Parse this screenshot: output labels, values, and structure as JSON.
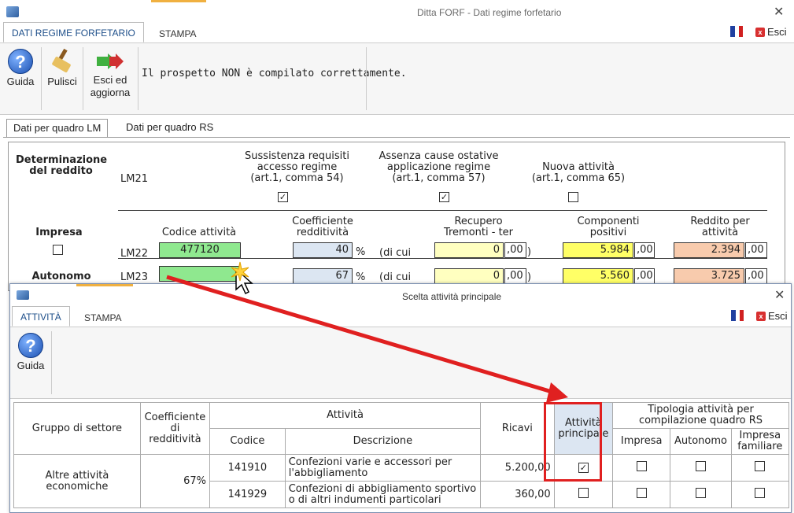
{
  "main_window": {
    "title": "Ditta FORF - Dati regime forfetario",
    "close": "✕",
    "ribbon_tabs": [
      "DATI REGIME FORFETARIO",
      "STAMPA"
    ],
    "esci": "Esci",
    "toolbar": {
      "guida": "Guida",
      "pulisci": "Pulisci",
      "esci_aggiorna_1": "Esci ed",
      "esci_aggiorna_2": "aggiorna",
      "status": "Il prospetto NON è compilato correttamente."
    },
    "doc_tabs": [
      "Dati per quadro LM",
      "Dati per quadro RS"
    ],
    "form": {
      "determinazione_1": "Determinazione",
      "determinazione_2": "del reddito",
      "lm21": "LM21",
      "sussistenza_1": "Sussistenza requisiti",
      "sussistenza_2": "accesso regime",
      "sussistenza_3": "(art.1, comma 54)",
      "assenza_1": "Assenza cause ostative",
      "assenza_2": "applicazione regime",
      "assenza_3": "(art.1, comma 57)",
      "nuova_1": "Nuova attività",
      "nuova_2": "(art.1, comma 65)",
      "check": "✓",
      "impresa": "Impresa",
      "autonomo": "Autonomo",
      "codice_attivita": "Codice attività",
      "coeff_1": "Coefficiente",
      "coeff_2": "redditività",
      "recupero_1": "Recupero",
      "recupero_2": "Tremonti - ter",
      "componenti_1": "Componenti",
      "componenti_2": "positivi",
      "reddito_1": "Reddito per",
      "reddito_2": "attività",
      "lm22": "LM22",
      "lm23": "LM23",
      "percent": "%",
      "di_cui": "(di cui",
      "zero": "0",
      "dec": ",00",
      "paren": ")",
      "lm22_codice": "477120",
      "lm22_coeff": "40",
      "lm22_componenti": "5.984",
      "lm22_reddito": "2.394",
      "lm23_codice": "",
      "lm23_coeff": "67",
      "lm23_componenti": "5.560",
      "lm23_reddito": "3.725"
    }
  },
  "dialog": {
    "title": "Scelta attività principale",
    "close": "✕",
    "ribbon_tabs": [
      "ATTIVITÀ",
      "STAMPA"
    ],
    "esci": "Esci",
    "guida": "Guida",
    "table": {
      "gruppo": "Gruppo di settore",
      "coeff_1": "Coefficiente",
      "coeff_2": "di redditività",
      "attivita": "Attività",
      "codice": "Codice",
      "descrizione": "Descrizione",
      "ricavi": "Ricavi",
      "principale_1": "Attività",
      "principale_2": "principale",
      "tipologia_1": "Tipologia attività per",
      "tipologia_2": "compilazione quadro RS",
      "impresa": "Impresa",
      "autonomo": "Autonomo",
      "familiare_1": "Impresa",
      "familiare_2": "familiare",
      "gruppo_value_1": "Altre attività",
      "gruppo_value_2": "economiche",
      "coeff_value": "67%",
      "rows": [
        {
          "codice": "141910",
          "desc_1": "Confezioni varie e accessori per",
          "desc_2": "l'abbigliamento",
          "ricavi": "5.200,00",
          "principale": "✓"
        },
        {
          "codice": "141929",
          "desc_1": "Confezioni di abbigliamento sportivo",
          "desc_2": "o di altri indumenti particolari",
          "ricavi": "360,00",
          "principale": ""
        }
      ]
    }
  },
  "colors": {
    "arrow": "#e02020",
    "green_field": "#8fe88f",
    "yellow_field": "#ffff66",
    "orange_field": "#f8cbad"
  }
}
